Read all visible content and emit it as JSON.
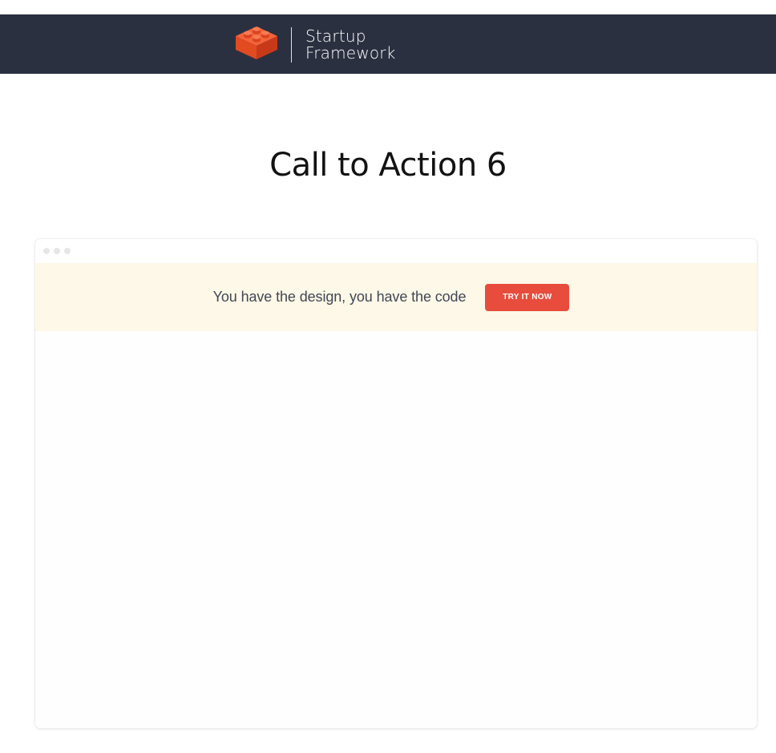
{
  "header": {
    "brand": {
      "line1": "Startup",
      "line2": "Framework",
      "logo_icon": "lego-brick-icon",
      "logo_color": "#f15a2b"
    },
    "background_color": "#2b3040"
  },
  "main": {
    "title": "Call to Action 6"
  },
  "preview": {
    "window_controls": [
      "dot",
      "dot",
      "dot"
    ],
    "cta": {
      "text": "You have the design, you have the code",
      "button_label": "TRY IT NOW",
      "button_color": "#e74c3c",
      "banner_color": "#fdf8e7"
    }
  }
}
